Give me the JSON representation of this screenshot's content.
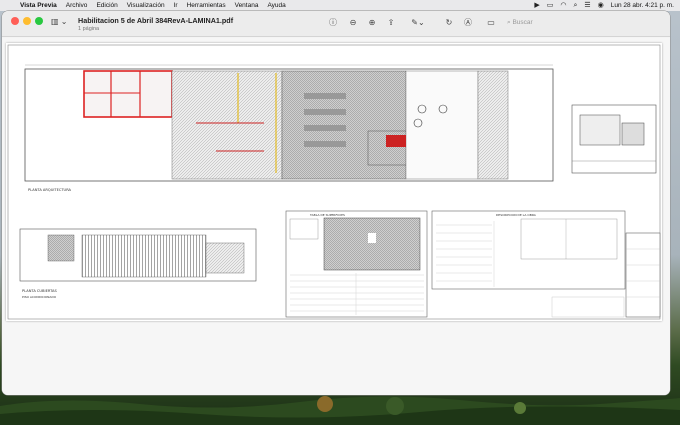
{
  "menubar": {
    "app_name": "Vista Previa",
    "items": [
      "Archivo",
      "Edición",
      "Visualización",
      "Ir",
      "Herramientas",
      "Ventana",
      "Ayuda"
    ],
    "datetime": "Lun 28 abr.  4:21 p. m."
  },
  "window": {
    "title": "Habilitacion 5 de Abril 384RevA-LAMINA1.pdf",
    "subtitle": "1 página",
    "search_placeholder": "Buscar"
  },
  "drawing": {
    "plan_label": "PLANTA ARQUITECTURA",
    "roof_label": "PLANTA CUBIERTAS",
    "roof_sub": "PISO ACONDICIONADO",
    "table1_title": "TABLA DE SUPERFICIES",
    "table2_title": "DESCRIPCION DE LA OBRA"
  }
}
